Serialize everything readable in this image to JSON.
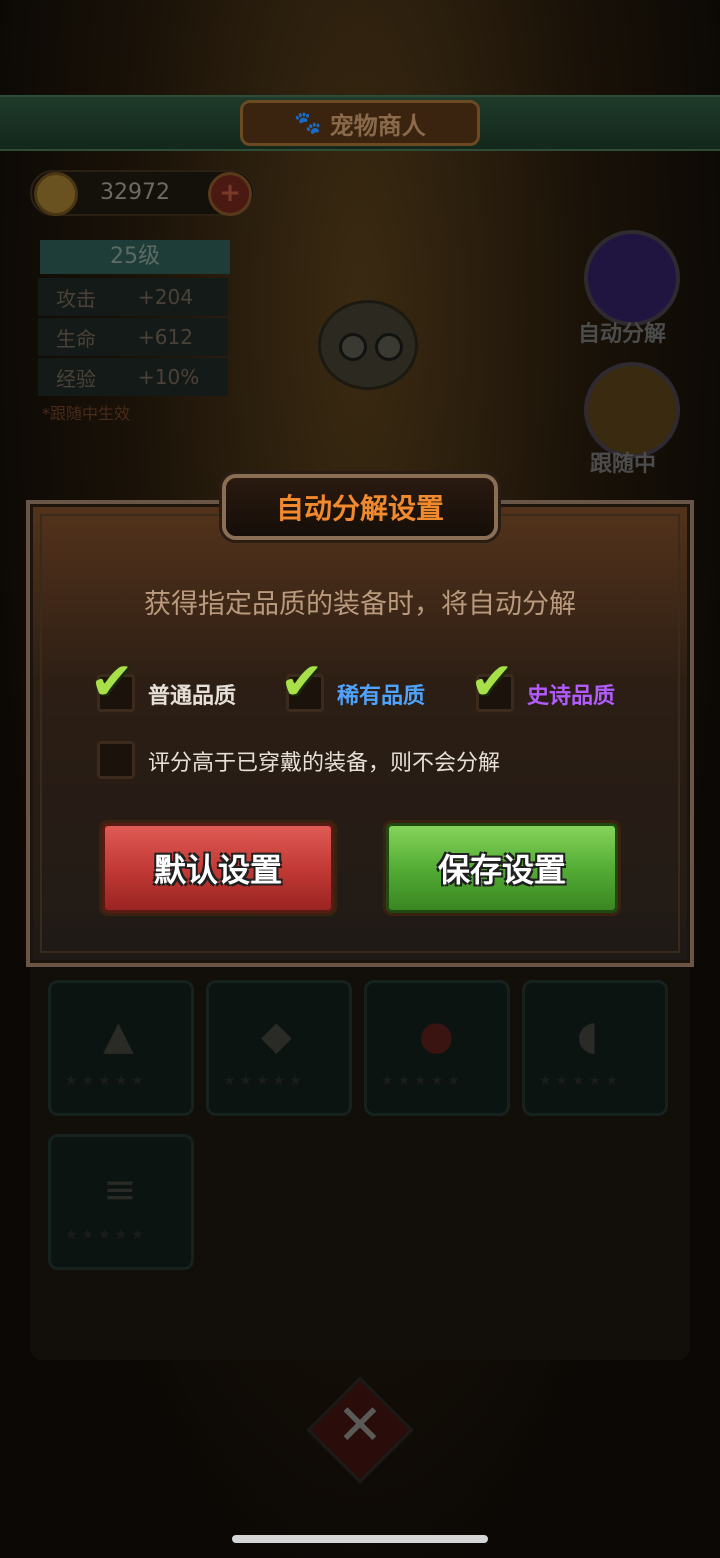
{
  "shop": {
    "title": "宠物商人",
    "coins": "32972",
    "level": "25级",
    "stats": [
      {
        "label": "攻击",
        "value": "+204"
      },
      {
        "label": "生命",
        "value": "+612"
      },
      {
        "label": "经验",
        "value": "+10%"
      }
    ],
    "follow_note": "*跟随中生效",
    "side_buttons": {
      "auto_decompose_label": "自动分解",
      "following_label": "跟随中"
    },
    "inventory_slots": [
      {
        "icon": "onion-pet-icon",
        "stars": "★★★★★"
      },
      {
        "icon": "chicken-pet-icon",
        "stars": "★★★★★"
      },
      {
        "icon": "daruma-pet-icon",
        "stars": "★★★★★"
      },
      {
        "icon": "bird-pet-icon",
        "stars": "★★★★★"
      },
      {
        "icon": "fish-bone-pet-icon",
        "stars": "★★★★★"
      }
    ]
  },
  "dialog": {
    "title": "自动分解设置",
    "description": "获得指定品质的装备时，将自动分解",
    "options": [
      {
        "label": "普通品质",
        "checked": true,
        "color": "#e6e0d8"
      },
      {
        "label": "稀有品质",
        "checked": true,
        "color": "#4fa3ff"
      },
      {
        "label": "史诗品质",
        "checked": true,
        "color": "#b25bff"
      }
    ],
    "score_option": {
      "label": "评分高于已穿戴的装备，则不会分解",
      "checked": false
    },
    "default_button": "默认设置",
    "save_button": "保存设置"
  },
  "colors": {
    "title_orange": "#f1892d",
    "check_green": "#a8e04a",
    "button_red": "#c33a36",
    "button_green": "#54ad35"
  }
}
